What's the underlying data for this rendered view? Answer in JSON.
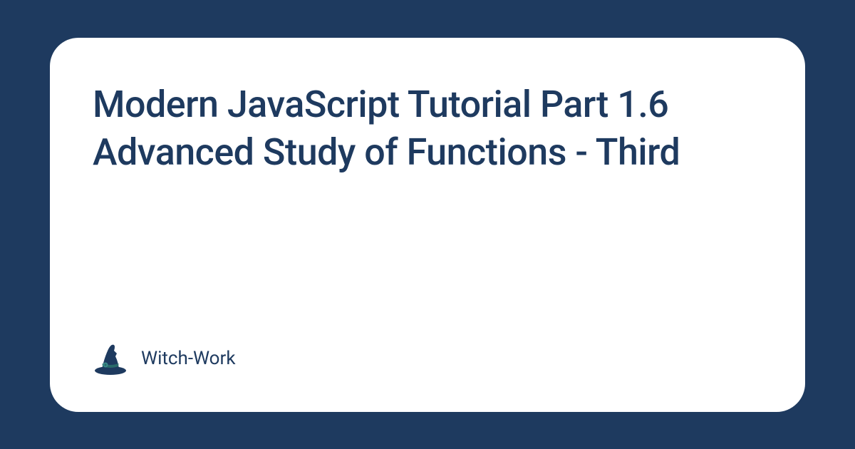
{
  "card": {
    "title": "Modern JavaScript Tutorial Part 1.6 Advanced Study of Functions - Third",
    "brand": "Witch-Work"
  }
}
